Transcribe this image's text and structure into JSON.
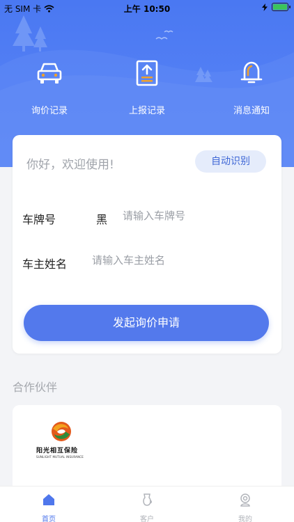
{
  "status_bar": {
    "carrier": "无 SIM 卡",
    "time": "上午 10:50"
  },
  "quick_nav": [
    {
      "label": "询价记录",
      "icon": "car-icon"
    },
    {
      "label": "上报记录",
      "icon": "upload-document-icon"
    },
    {
      "label": "消息通知",
      "icon": "bell-icon"
    }
  ],
  "form": {
    "greeting": "你好，欢迎使用!",
    "auto_detect_label": "自动识别",
    "plate_label": "车牌号",
    "plate_prefix": "黑",
    "plate_placeholder": "请输入车牌号",
    "owner_label": "车主姓名",
    "owner_placeholder": "请输入车主姓名",
    "submit_label": "发起询价申请"
  },
  "partners": {
    "title": "合作伙伴",
    "items": [
      {
        "name": "阳光相互保险",
        "subtitle": "SUNLIGHT MUTUAL INSURANCE"
      }
    ]
  },
  "tabs": [
    {
      "label": "首页",
      "icon": "home-icon",
      "active": true
    },
    {
      "label": "客户",
      "icon": "customer-icon",
      "active": false
    },
    {
      "label": "我的",
      "icon": "profile-icon",
      "active": false
    }
  ],
  "colors": {
    "primary": "#5379ec",
    "header": "#4a78f2",
    "accent_orange": "#f0a12a"
  }
}
